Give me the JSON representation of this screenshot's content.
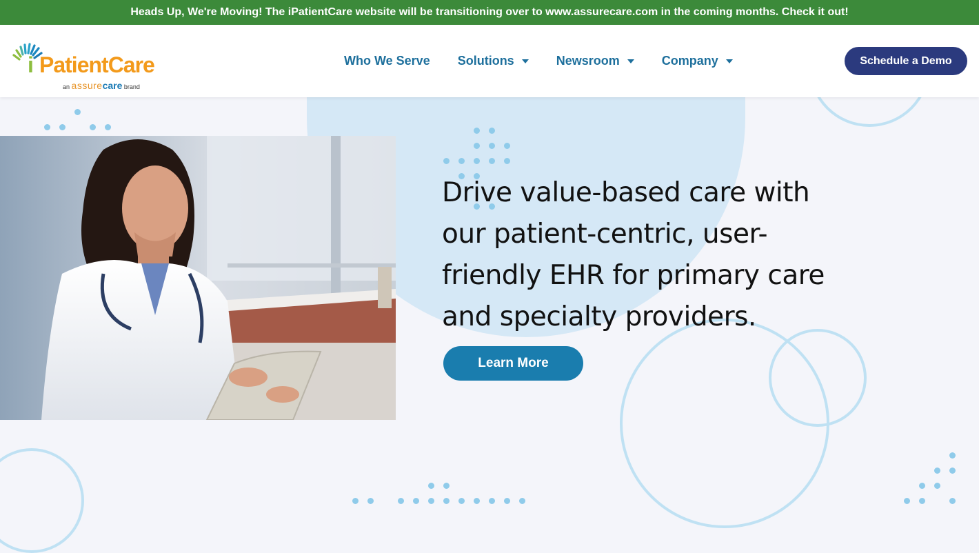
{
  "announcement": {
    "text": "Heads Up, We're Moving! The iPatientCare website will be transitioning over to www.assurecare.com in the coming months. Check it out!"
  },
  "logo": {
    "i": "i",
    "name": "PatientCare",
    "sub_prefix": "an",
    "sub_assure": "assure",
    "sub_care": "care",
    "sub_suffix": "brand"
  },
  "nav": {
    "items": [
      {
        "label": "Who We Serve",
        "dropdown": false
      },
      {
        "label": "Solutions",
        "dropdown": true
      },
      {
        "label": "Newsroom",
        "dropdown": true
      },
      {
        "label": "Company",
        "dropdown": true
      }
    ],
    "cta_label": "Schedule a Demo"
  },
  "hero": {
    "headline": "Drive value-based care with our patient-centric, user-friendly EHR for primary care and specialty providers.",
    "button_label": "Learn More"
  },
  "colors": {
    "announcement_bg": "#3c8a3a",
    "nav_text": "#1d6f9c",
    "cta_bg": "#2b3a7e",
    "hero_button_bg": "#1a7dae",
    "decor_blue": "#bfe1f3"
  },
  "icons": [
    "logo-sunburst-icon",
    "chevron-down-icon"
  ]
}
